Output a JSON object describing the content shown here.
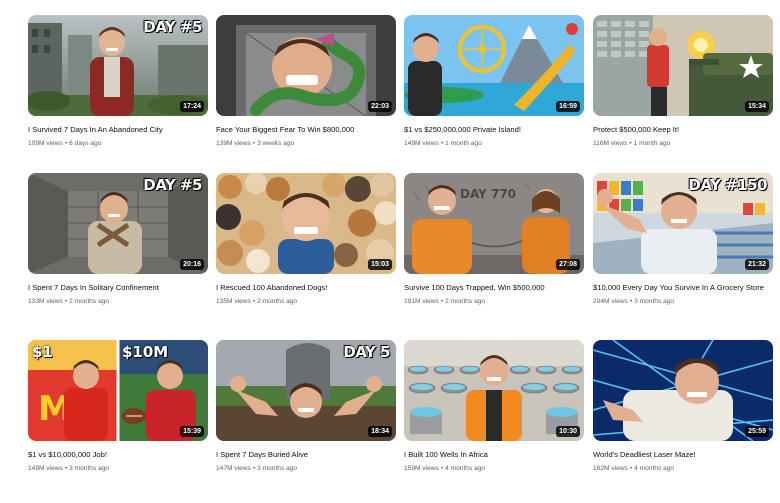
{
  "videos": [
    {
      "title": "I Survived 7 Days In An Abandoned City",
      "views": "109M views",
      "age": "6 days ago",
      "duration": "17:24",
      "badge": "DAY #5"
    },
    {
      "title": "Face Your Biggest Fear To Win $800,000",
      "views": "139M views",
      "age": "3 weeks ago",
      "duration": "22:03",
      "badge": ""
    },
    {
      "title": "$1 vs $250,000,000 Private Island!",
      "views": "149M views",
      "age": "1 month ago",
      "duration": "16:59",
      "badge": ""
    },
    {
      "title": "Protect $500,000 Keep It!",
      "views": "116M views",
      "age": "1 month ago",
      "duration": "15:34",
      "badge": ""
    },
    {
      "title": "I Spent 7 Days In Solitary Confinement",
      "views": "133M views",
      "age": "2 months ago",
      "duration": "20:16",
      "badge": "DAY #5"
    },
    {
      "title": "I Rescued 100 Abandoned Dogs!",
      "views": "135M views",
      "age": "2 months ago",
      "duration": "15:03",
      "badge": ""
    },
    {
      "title": "Survive 100 Days Trapped, Win $500,000",
      "views": "191M views",
      "age": "2 months ago",
      "duration": "27:08",
      "badge": ""
    },
    {
      "title": "$10,000 Every Day You Survive In A Grocery Store",
      "views": "204M views",
      "age": "3 months ago",
      "duration": "21:32",
      "badge": "DAY #150"
    },
    {
      "title": "$1 vs $10,000,000 Job!",
      "views": "148M views",
      "age": "3 months ago",
      "duration": "15:39",
      "badge": ""
    },
    {
      "title": "I Spent 7 Days Buried Alive",
      "views": "147M views",
      "age": "3 months ago",
      "duration": "18:34",
      "badge": "DAY 5"
    },
    {
      "title": "I Built 100 Wells In Africa",
      "views": "159M views",
      "age": "4 months ago",
      "duration": "10:30",
      "badge": ""
    },
    {
      "title": "World's Deadliest Laser Maze!",
      "views": "162M views",
      "age": "4 months ago",
      "duration": "25:59",
      "badge": ""
    }
  ],
  "thumb_text": {
    "v6_wall": "DAY 770",
    "v8_left": "$1",
    "v8_right": "$10M"
  },
  "colors": {
    "title_text": "#0f0f0f",
    "meta_text": "#606060",
    "duration_bg": "#000000"
  }
}
